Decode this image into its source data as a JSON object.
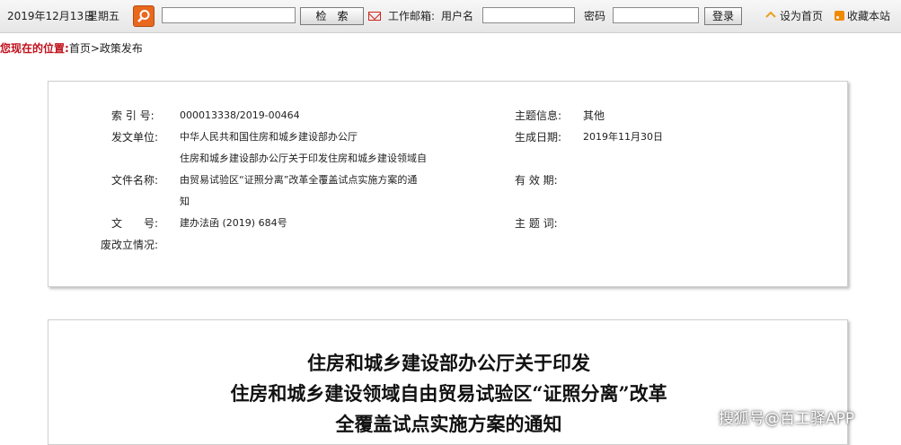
{
  "topbar": {
    "date": "2019年12月13日",
    "weekday": "星期五",
    "search_value": "",
    "search_button": "检　索",
    "mail_label": "工作邮箱:",
    "username_label": "用户名",
    "username_value": "",
    "password_label": "密码",
    "password_value": "",
    "login_button": "登录",
    "set_home": "设为首页",
    "bookmark": "收藏本站"
  },
  "breadcrumb": {
    "label": "您现在的位置:",
    "path": "首页>政策发布"
  },
  "info": {
    "index_label": "索 引 号:",
    "index_value": "000013338/2019-00464",
    "topic_label": "主题信息:",
    "topic_value": "其他",
    "issuer_label": "发文单位:",
    "issuer_value": "中华人民共和国住房和城乡建设部办公厅",
    "date_label": "生成日期:",
    "date_value": "2019年11月30日",
    "name_label": "文件名称:",
    "name_line1": "住房和城乡建设部办公厅关于印发住房和城乡建设领域自",
    "name_line2": "由贸易试验区“证照分离”改革全覆盖试点实施方案的通",
    "name_line3": "知",
    "validity_label": "有 效 期:",
    "docno_label": "文　　号:",
    "docno_value": "建办法函 (2019) 684号",
    "keywords_label": "主 题 词:",
    "repeal_label": "废改立情况:"
  },
  "document": {
    "title_line1": "住房和城乡建设部办公厅关于印发",
    "title_line2": "住房和城乡建设领域自由贸易试验区“证照分离”改革",
    "title_line3": "全覆盖试点实施方案的通知"
  },
  "watermark": "搜狐号@百工驿APP",
  "colors": {
    "accent_red": "#c0111b",
    "search_orange": "#e8681d"
  },
  "icons": {
    "search": "magnifier-icon",
    "mail": "envelope-icon",
    "home": "house-icon",
    "bookmark": "rss-icon"
  }
}
